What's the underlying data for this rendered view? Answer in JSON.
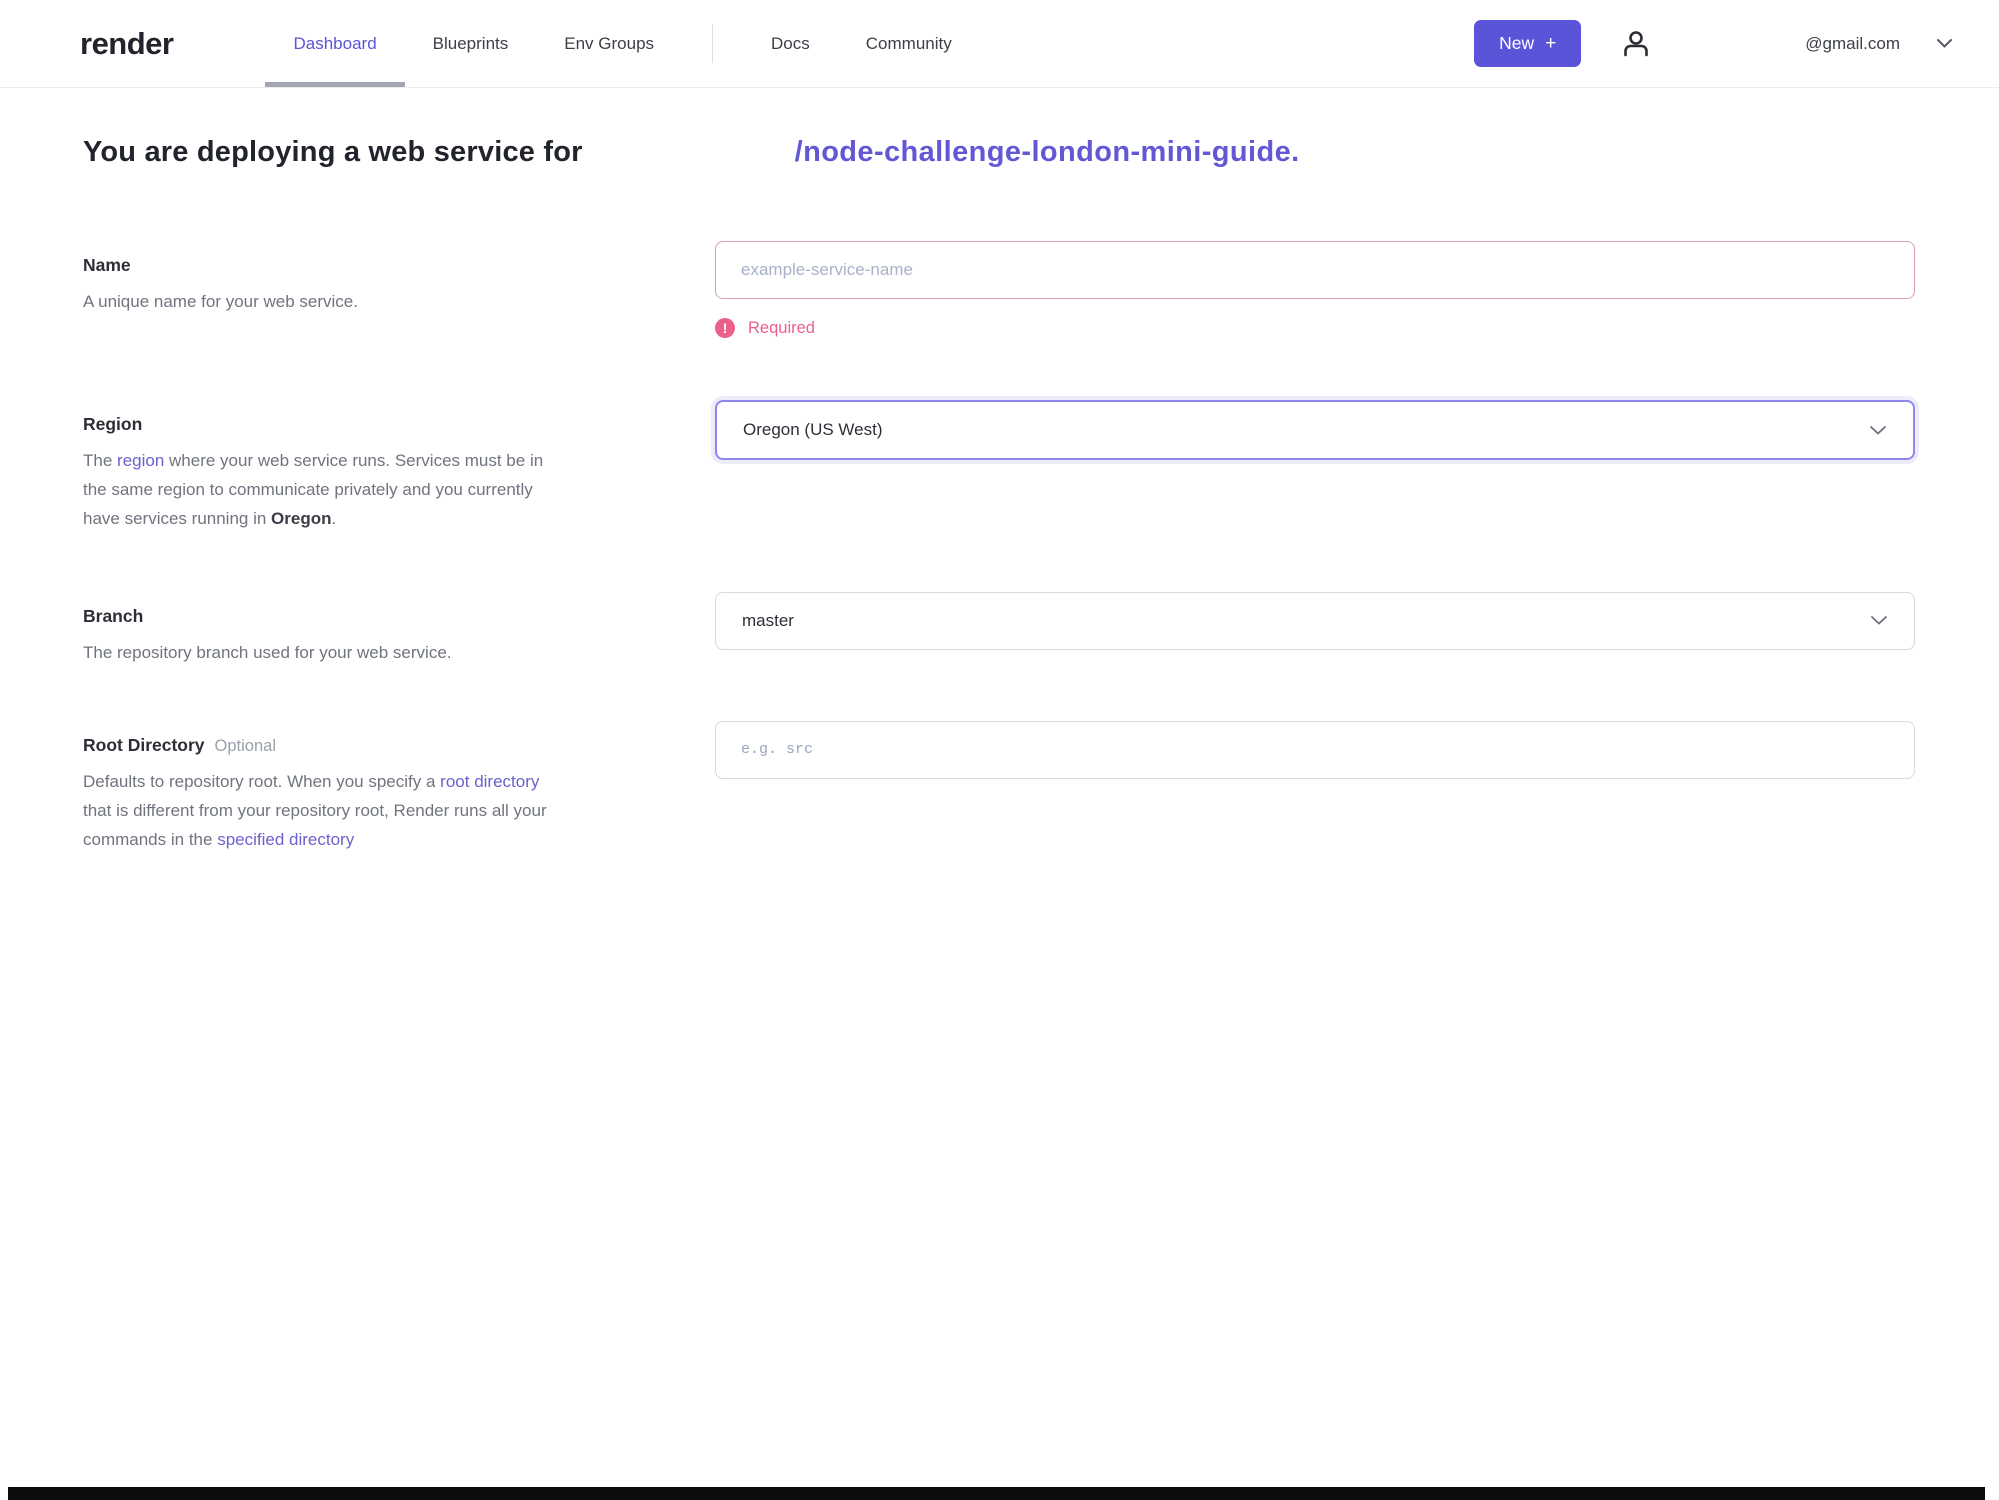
{
  "colors": {
    "brand_purple": "#5a54d9",
    "link_purple": "#6b62cf",
    "error_pink": "#ec5f8a"
  },
  "nav": {
    "logo": "render",
    "items": [
      {
        "label": "Dashboard",
        "active": true
      },
      {
        "label": "Blueprints",
        "active": false
      },
      {
        "label": "Env Groups",
        "active": false
      },
      {
        "label": "Docs",
        "active": false
      },
      {
        "label": "Community",
        "active": false
      }
    ],
    "new_button": {
      "label": "New",
      "plus": "+"
    },
    "account": {
      "email": "@gmail.com"
    }
  },
  "heading": {
    "prefix": "You are deploying a web service for",
    "repo": "/node-challenge-london-mini-guide."
  },
  "form": {
    "name": {
      "label": "Name",
      "description": "A unique name for your web service.",
      "placeholder": "example-service-name",
      "error": "Required"
    },
    "region": {
      "label": "Region",
      "desc_part1": "The ",
      "desc_link": "region",
      "desc_part2": " where your web service runs. Services must be in the same region to communicate privately and you currently have services running in ",
      "desc_bold": "Oregon",
      "desc_part3": ".",
      "value": "Oregon (US West)"
    },
    "branch": {
      "label": "Branch",
      "description": "The repository branch used for your web service.",
      "value": "master"
    },
    "root_directory": {
      "label": "Root Directory",
      "optional": "Optional",
      "desc_part1": "Defaults to repository root. When you specify a ",
      "desc_link1": "root directory",
      "desc_part2": " that is different from your repository root, Render runs all your commands in the ",
      "desc_link2": "specified directory",
      "placeholder": "e.g. src"
    }
  }
}
